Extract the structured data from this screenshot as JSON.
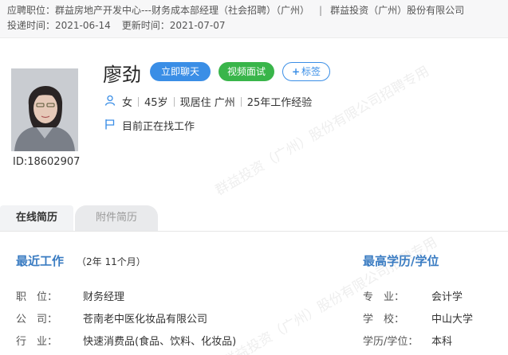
{
  "top": {
    "position_label": "应聘职位：",
    "position_value": "群益房地产开发中心---财务成本部经理（社会招聘）（广州）",
    "separator": "|",
    "company": "群益投资（广州）股份有限公司",
    "delivered_label": "投递时间：",
    "delivered_value": "2021-06-14",
    "updated_label": "更新时间：",
    "updated_value": "2021-07-07"
  },
  "candidate": {
    "name": "廖劲",
    "id_text": "ID:18602907",
    "gender": "女",
    "age": "45岁",
    "residence": "现居住 广州",
    "experience": "25年工作经验",
    "status": "目前正在找工作"
  },
  "actions": {
    "chat": "立即聊天",
    "video": "视频面试",
    "tag": "标签"
  },
  "tabs": {
    "online": "在线简历",
    "attachment": "附件简历"
  },
  "recent_work": {
    "title": "最近工作",
    "duration": "（2年 11个月）",
    "rows": [
      {
        "label": "职　位：",
        "value": "财务经理"
      },
      {
        "label": "公　司：",
        "value": "苍南老中医化妆品有限公司"
      },
      {
        "label": "行　业：",
        "value": "快速消费品(食品、饮料、化妆品)"
      }
    ]
  },
  "education": {
    "title": "最高学历/学位",
    "rows": [
      {
        "label": "专　业：",
        "value": "会计学"
      },
      {
        "label": "学　校：",
        "value": "中山大学"
      },
      {
        "label": "学历/学位：",
        "value": "本科"
      }
    ]
  },
  "watermark": {
    "text1": "群益投资（广州）股份有限公司招聘专用",
    "text2": "群益投资（广州）股份有限公司招聘专用"
  },
  "colors": {
    "accent_blue": "#3a8ee6",
    "accent_green": "#39b54a",
    "section_blue": "#3a7cc2"
  }
}
